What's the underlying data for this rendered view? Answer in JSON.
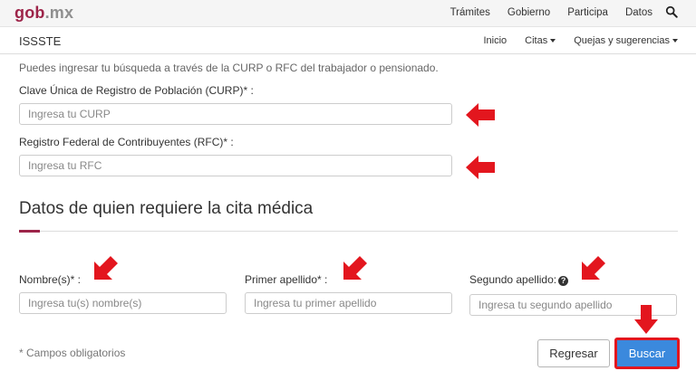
{
  "header": {
    "logo_main": "gob",
    "logo_domain": ".mx",
    "nav": [
      "Trámites",
      "Gobierno",
      "Participa",
      "Datos"
    ],
    "search_icon": "search-icon"
  },
  "subheader": {
    "brand": "ISSSTE",
    "nav": {
      "inicio": "Inicio",
      "citas": "Citas",
      "quejas": "Quejas y sugerencias"
    }
  },
  "form": {
    "intro": "Puedes ingresar tu búsqueda a través de la CURP o RFC del trabajador o pensionado.",
    "curp_label": "Clave Única de Registro de Población (CURP)* :",
    "curp_placeholder": "Ingresa tu CURP",
    "rfc_label": "Registro Federal de Contribuyentes (RFC)* :",
    "rfc_placeholder": "Ingresa tu RFC",
    "section_title": "Datos de quien requiere la cita médica",
    "nombre_label": "Nombre(s)* :",
    "nombre_placeholder": "Ingresa tu(s) nombre(s)",
    "primer_label": "Primer apellido* :",
    "primer_placeholder": "Ingresa tu primer apellido",
    "segundo_label": "Segundo apellido:",
    "segundo_placeholder": "Ingresa tu segundo apellido",
    "help_icon_glyph": "?",
    "required_note": "* Campos obligatorios",
    "back_button": "Regresar",
    "search_button": "Buscar"
  },
  "colors": {
    "brand": "#9d2449",
    "primary": "#3b89dd",
    "highlight": "#e3161e"
  }
}
